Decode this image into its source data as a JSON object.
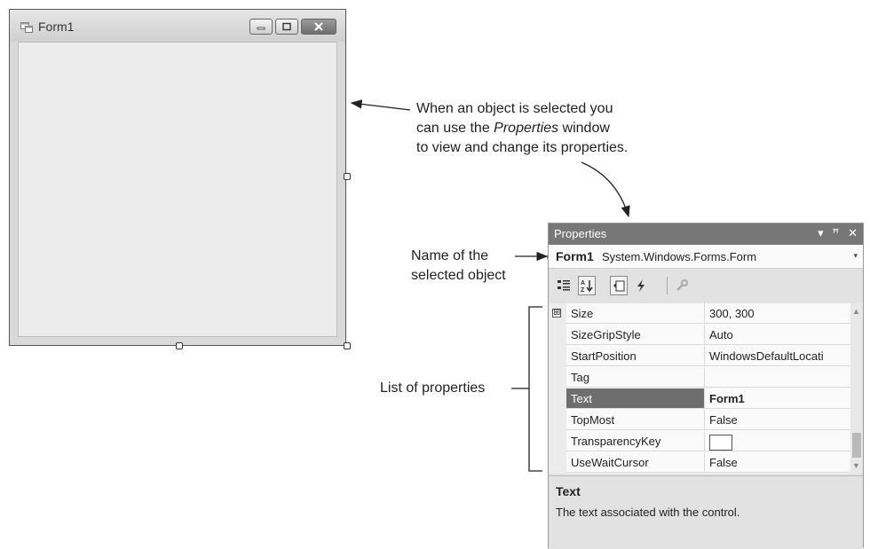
{
  "form": {
    "title": "Form1",
    "buttons": [
      "minimize-icon",
      "maximize-icon",
      "close-icon"
    ]
  },
  "annotations": {
    "callout_line1": "When an object is selected you",
    "callout_line2_pre": "can use the ",
    "callout_line2_em": "Properties",
    "callout_line2_post": " window",
    "callout_line3": "to view and change its properties.",
    "name_label_line1": "Name of the",
    "name_label_line2": "selected object",
    "list_label": "List of properties"
  },
  "properties": {
    "title": "Properties",
    "title_icons": [
      "dropdown-icon",
      "pin-icon",
      "close-icon"
    ],
    "object_name": "Form1",
    "object_type": "System.Windows.Forms.Form",
    "toolbar": [
      "categorized-icon",
      "alphabetical-icon",
      "properties-icon",
      "events-icon",
      "property-pages-icon"
    ],
    "rows": [
      {
        "name": "Size",
        "value": "300, 300",
        "expandable": true,
        "expander": "⊞"
      },
      {
        "name": "SizeGripStyle",
        "value": "Auto"
      },
      {
        "name": "StartPosition",
        "value": "WindowsDefaultLocati"
      },
      {
        "name": "Tag",
        "value": ""
      },
      {
        "name": "Text",
        "value": "Form1",
        "selected": true
      },
      {
        "name": "TopMost",
        "value": "False"
      },
      {
        "name": "TransparencyKey",
        "value": "",
        "swatch": "#ffffff"
      },
      {
        "name": "UseWaitCursor",
        "value": "False"
      }
    ],
    "description_title": "Text",
    "description_text": "The text associated with the control."
  },
  "colors": {
    "titlebar": "#777777",
    "selected_row": "#6e6e6e"
  }
}
